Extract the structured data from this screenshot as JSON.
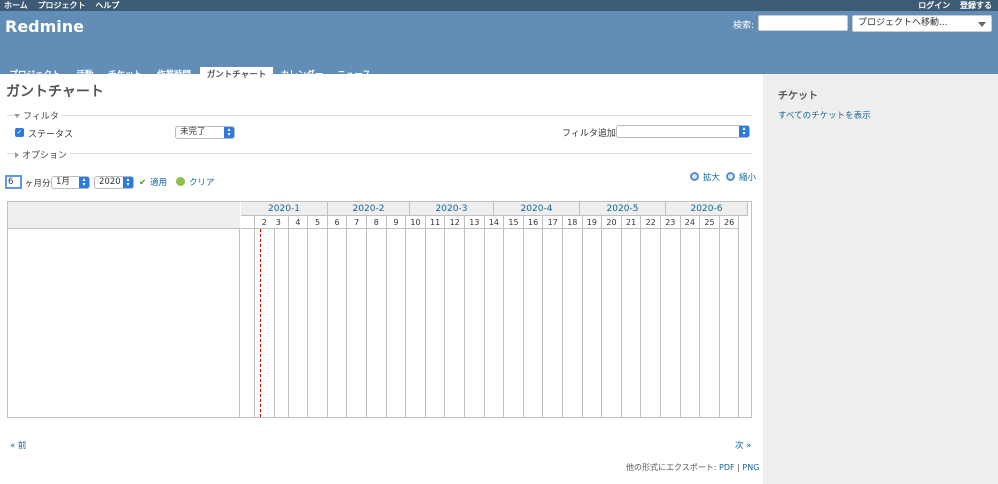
{
  "top_menu": {
    "left": [
      "ホーム",
      "プロジェクト",
      "ヘルプ"
    ],
    "right": [
      "ログイン",
      "登録する"
    ]
  },
  "header": {
    "logo": "Redmine",
    "search_label": "検索:",
    "search_value": "",
    "jump_label": "プロジェクトへ移動..."
  },
  "main_menu": {
    "tabs": [
      "プロジェクト",
      "活動",
      "チケット",
      "作業時間",
      "ガントチャート",
      "カレンダー",
      "ニュース"
    ],
    "selected": "ガントチャート"
  },
  "content": {
    "title": "ガントチャート",
    "filter_legend": "フィルタ",
    "status_label": "ステータス",
    "status_value": "未完了",
    "add_filter_label": "フィルタ追加",
    "add_filter_value": "",
    "options_legend": "オプション",
    "months_value": "6",
    "months_label": "ヶ月分",
    "month_select": "1月",
    "year_select": "2020",
    "apply": "適用",
    "clear": "クリア",
    "zoom_in": "拡大",
    "zoom_out": "縮小",
    "prev": "« 前",
    "next": "次 »",
    "export_label": "他の形式にエクスポート:",
    "export_pdf": "PDF",
    "export_sep": "|",
    "export_png": "PNG"
  },
  "gantt": {
    "months": [
      "2020-1",
      "2020-2",
      "2020-3",
      "2020-4",
      "2020-5",
      "2020-6"
    ],
    "weeks": [
      "2",
      "3",
      "4",
      "5",
      "6",
      "7",
      "8",
      "9",
      "10",
      "11",
      "12",
      "13",
      "14",
      "15",
      "16",
      "17",
      "18",
      "19",
      "20",
      "21",
      "22",
      "23",
      "24",
      "25",
      "26"
    ]
  },
  "sidebar": {
    "title": "チケット",
    "link": "すべてのチケットを表示"
  },
  "colors": {
    "header": "#628db6",
    "top_menu": "#3e5b76",
    "link": "#169",
    "today_line": "#d00"
  }
}
